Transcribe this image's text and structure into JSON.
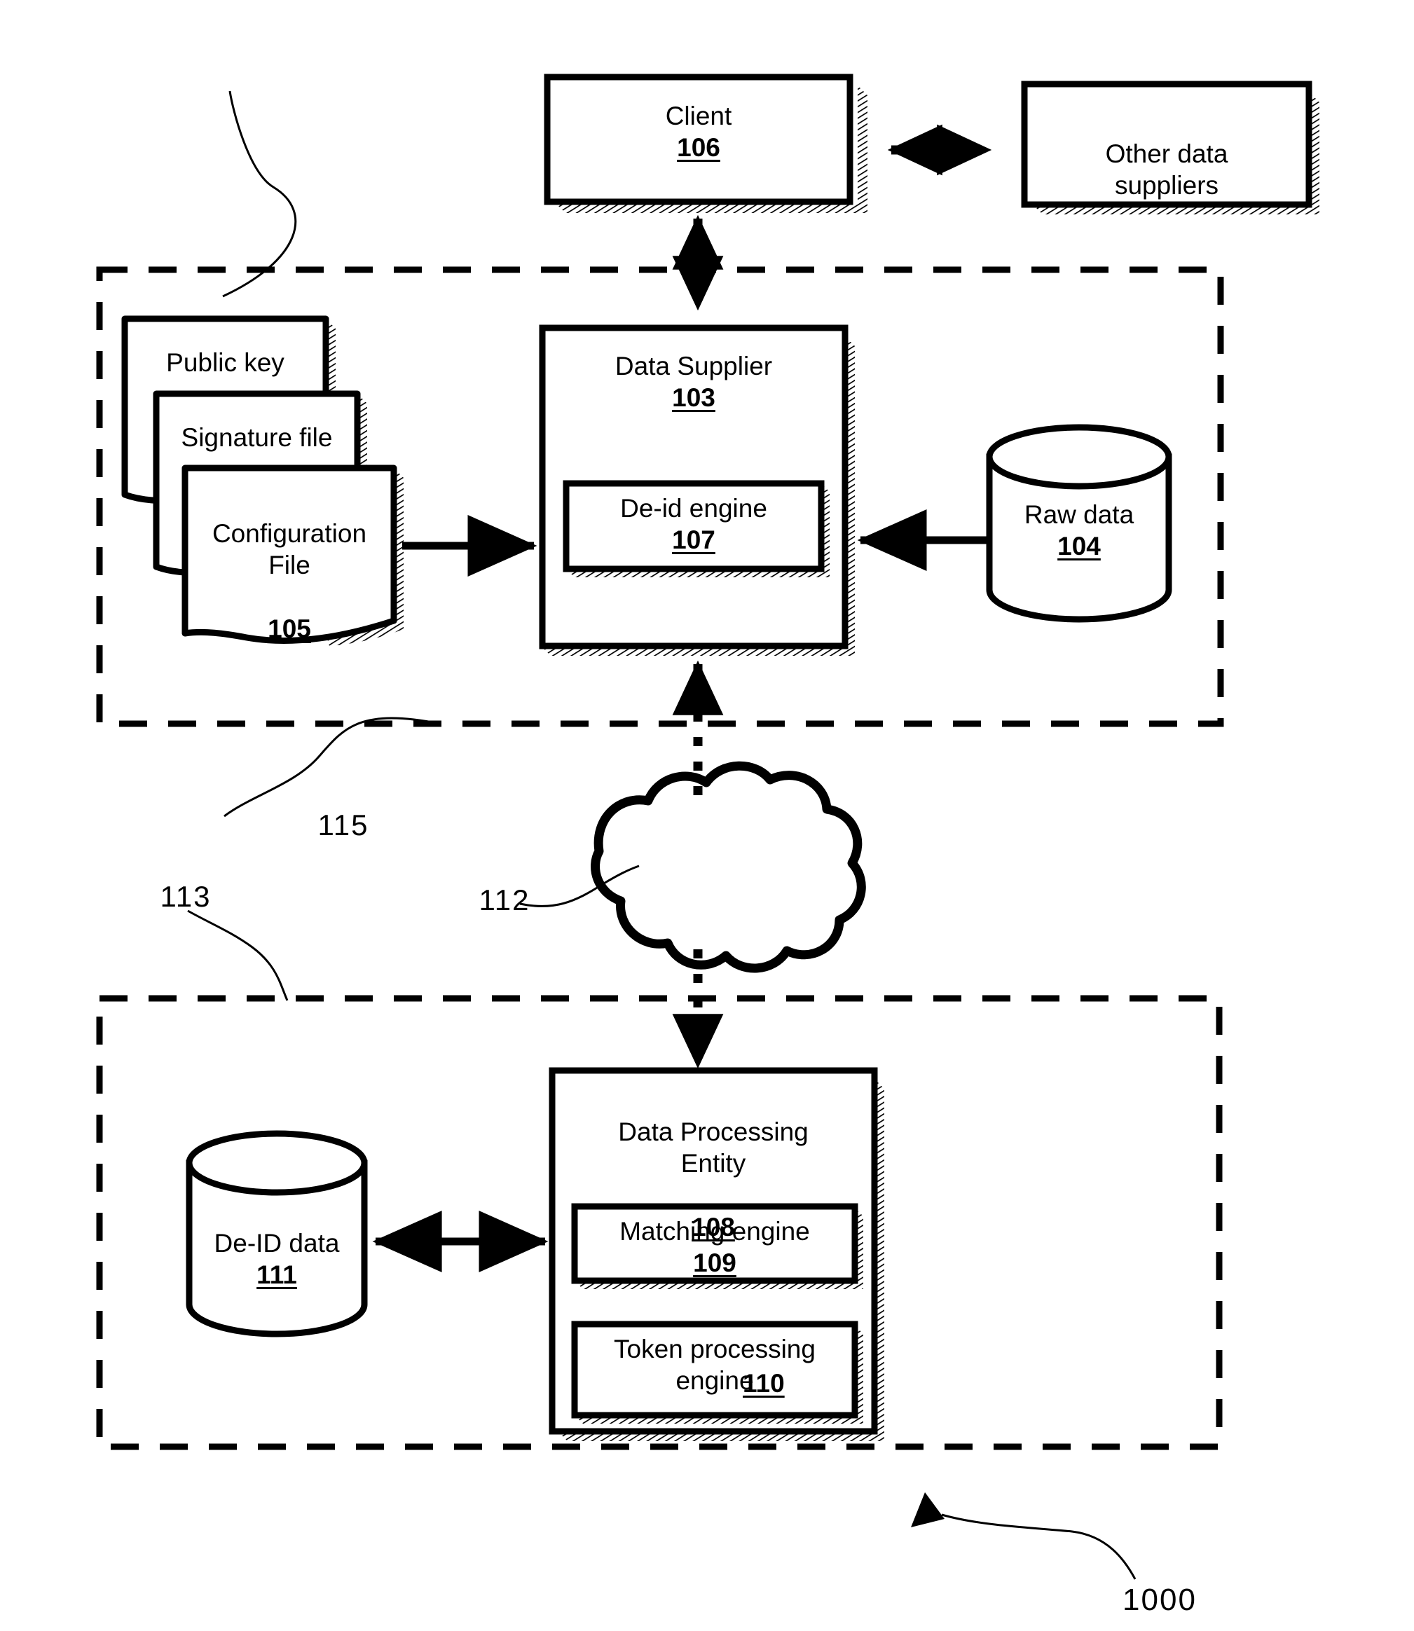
{
  "figure": {
    "figure_number": "1000",
    "type": "patent-system-diagram"
  },
  "nodes": {
    "client": {
      "label": "Client",
      "ref": "106"
    },
    "other_suppliers": {
      "label": "Other data\nsuppliers",
      "ref": ""
    },
    "public_key": {
      "label": "Public key",
      "ref": ""
    },
    "signature_file": {
      "label": "Signature file",
      "ref": ""
    },
    "configuration_file": {
      "label": "Configuration\nFile",
      "ref": "105"
    },
    "data_supplier": {
      "label": "Data Supplier",
      "ref": "103"
    },
    "de_id_engine": {
      "label": "De-id engine",
      "ref": "107"
    },
    "raw_data": {
      "label": "Raw data",
      "ref": "104"
    },
    "cloud": {
      "label": "",
      "ref": "112"
    },
    "data_processing_entity": {
      "label": "Data Processing\nEntity",
      "ref": "108"
    },
    "matching_engine": {
      "label": "Matching engine",
      "ref": "109"
    },
    "token_processing_engine": {
      "label": "Token processing\nengine",
      "ref": "110"
    },
    "de_id_data": {
      "label": "De-ID data",
      "ref": "111"
    }
  },
  "boundaries": {
    "supplier_domain": {
      "ref": "115"
    },
    "processing_domain": {
      "ref": "113"
    }
  },
  "colors": {
    "stroke": "#000000",
    "fill": "#ffffff",
    "shadow": "#000000"
  }
}
